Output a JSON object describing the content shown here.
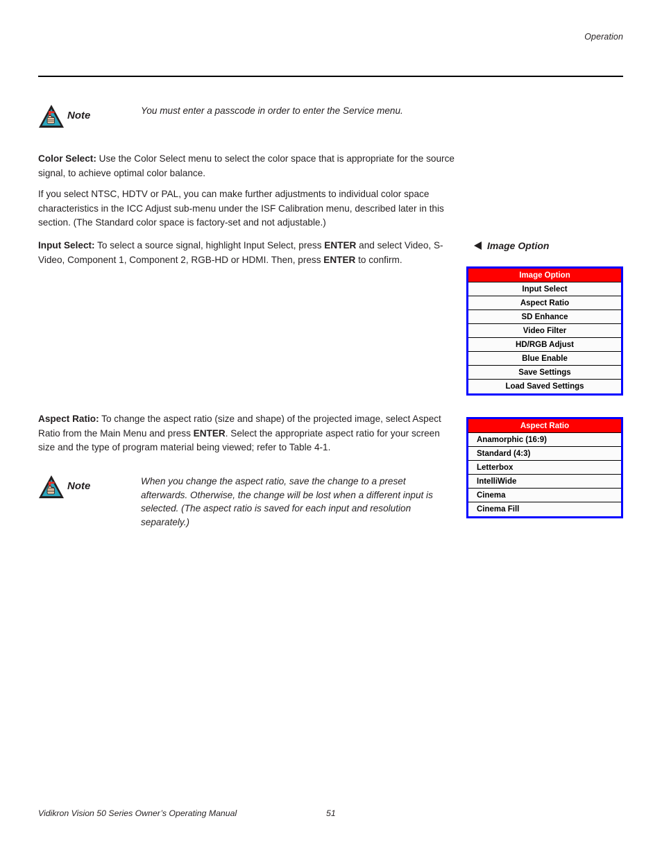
{
  "header": {
    "section_title": "Operation"
  },
  "notes": [
    {
      "icon": "note-triangle-hand-icon",
      "label": "Note",
      "text": "You must enter a passcode in order to enter the Service menu."
    },
    {
      "icon": "note-triangle-hand-icon",
      "label": "Note",
      "text": "When you change the aspect ratio, save the change to a preset afterwards. Otherwise, the change will be lost when a different input is selected. (The aspect ratio is saved for each input and resolution separately.)"
    }
  ],
  "body": {
    "color_select": {
      "term": "Color Select:",
      "text": " Use the Color Select menu to select the color space that is appropriate for the source signal, to achieve optimal color balance."
    },
    "color_select_detail": "If you select NTSC, HDTV or PAL, you can make further adjustments to individual color space characteristics in the ICC Adjust sub-menu under the ISF Calibration menu, described later in this section. (The Standard color space is factory-set and not adjustable.)",
    "input_select": {
      "term": "Input Select:",
      "part1": " To select a source signal, highlight Input Select, press ",
      "emph1": "ENTER",
      "part2": " and select Video, S-Video, Component 1, Component 2, RGB-HD or HDMI. Then, press ",
      "emph2": "ENTER",
      "part3": " to confirm."
    },
    "aspect_ratio": {
      "term": "Aspect Ratio:",
      "part1": " To change the aspect ratio (size and shape) of the projected image, select Aspect Ratio from the Main Menu and press ",
      "emph1": "ENTER",
      "part2": ". Select the appropriate aspect ratio for your screen size and the type of program material being viewed; refer to Table 4-1."
    }
  },
  "callouts": {
    "image_option": {
      "arrow": "arrow-left-icon",
      "title": "Image Option"
    }
  },
  "menus": {
    "image_option": {
      "header": "Image Option",
      "items": [
        "Input Select",
        "Aspect Ratio",
        "SD Enhance",
        "Video Filter",
        "HD/RGB Adjust",
        "Blue Enable",
        "Save Settings",
        "Load Saved Settings"
      ]
    },
    "aspect_ratio": {
      "header": "Aspect Ratio",
      "items": [
        "Anamorphic (16:9)",
        "Standard (4:3)",
        "Letterbox",
        "IntelliWide",
        "Cinema",
        "Cinema Fill"
      ]
    }
  },
  "footer": {
    "manual_title": "Vidikron Vision 50 Series Owner’s Operating Manual",
    "page_number": "51"
  },
  "colors": {
    "menu_border": "#0000FF",
    "menu_header_bg": "#FF0000",
    "menu_header_text": "#FFFFFF",
    "text": "#231F20"
  }
}
